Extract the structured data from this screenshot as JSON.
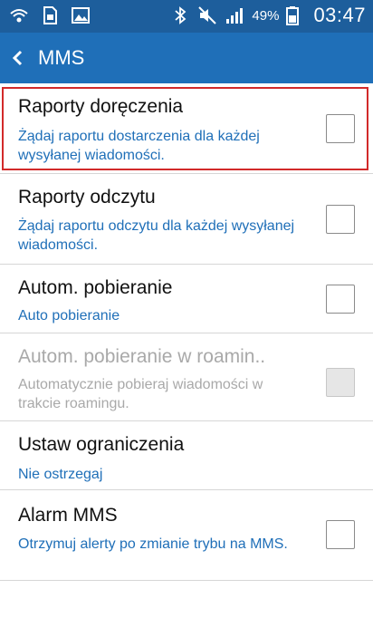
{
  "status_bar": {
    "battery_percent": "49%",
    "time": "03:47",
    "icons": [
      "wifi-call-icon",
      "sim-icon",
      "image-icon",
      "bluetooth-icon",
      "mute-icon",
      "signal-icon",
      "battery-icon"
    ]
  },
  "app_bar": {
    "title": "MMS"
  },
  "settings": [
    {
      "title": "Raporty doręczenia",
      "subtitle": "Żądaj raportu dostarczenia dla każdej wysyłanej wiadomości.",
      "checked": false
    },
    {
      "title": "Raporty odczytu",
      "subtitle": "Żądaj raportu odczytu dla każdej wysyłanej wiadomości.",
      "checked": false
    },
    {
      "title": "Autom. pobieranie",
      "subtitle": "Auto pobieranie",
      "checked": false
    },
    {
      "title": "Autom. pobieranie w roamin..",
      "subtitle": "Automatycznie pobieraj wiadomości w trakcie roamingu.",
      "checked": false,
      "disabled": true
    },
    {
      "title": "Ustaw ograniczenia",
      "subtitle": "Nie ostrzegaj"
    },
    {
      "title": "Alarm MMS",
      "subtitle": "Otrzymuj alerty po zmianie trybu na MMS.",
      "checked": false
    }
  ],
  "colors": {
    "status_bar": "#1d5e9c",
    "app_bar": "#1f6fb8",
    "accent_text": "#1f6fb8",
    "highlight": "#d22a2a"
  }
}
